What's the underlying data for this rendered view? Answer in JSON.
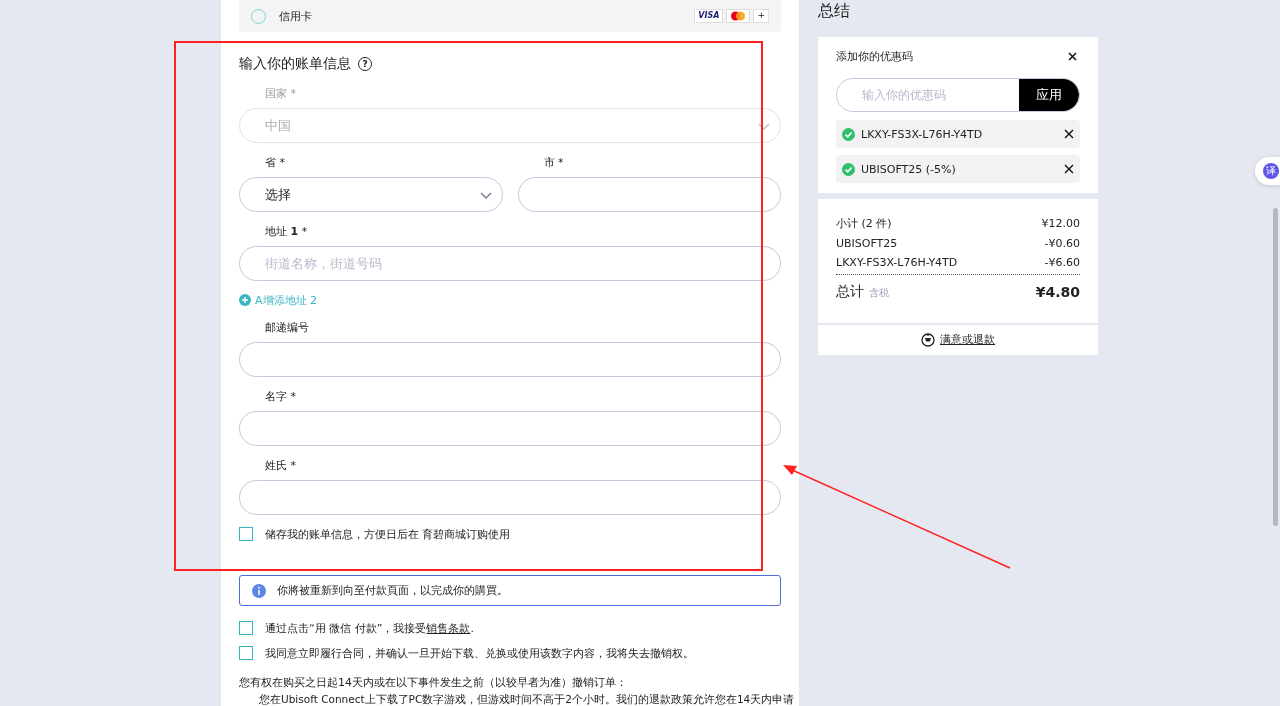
{
  "payment_option": {
    "label": "信用卡",
    "selected": false,
    "visa": "VISA",
    "more": "+"
  },
  "billing": {
    "title": "输入你的账单信息",
    "help": "?",
    "items": [
      {
        "kind": "field",
        "label": "国家 *",
        "value": "中国",
        "select": true,
        "disabled": true
      },
      {
        "kind": "pair",
        "fields": [
          {
            "label": "省 *",
            "value": "选择",
            "select": true,
            "disabled": false
          },
          {
            "label": "市 *",
            "select": false,
            "disabled": false
          }
        ]
      },
      {
        "kind": "field",
        "label": "地址 **1** *",
        "placeholder": "街道名称，街道号码",
        "select": false,
        "disabled": false
      },
      {
        "kind": "link",
        "label": "A增添地址 2"
      },
      {
        "kind": "field",
        "label": "邮递编号",
        "select": false,
        "disabled": false
      },
      {
        "kind": "field",
        "label": "名字 *",
        "select": false,
        "disabled": false
      },
      {
        "kind": "field",
        "label": "姓氏 *",
        "select": false,
        "disabled": false
      },
      {
        "kind": "checkbox",
        "label": "储存我的账单信息，方便日后在 育碧商城订购使用",
        "checked": false
      }
    ]
  },
  "notice": "你將被重新到向至付款頁面，以完成你的購買。",
  "consents": [
    {
      "text": "通过点击“用 微信 付款”，我接受",
      "link": "销售条款",
      "after": ".",
      "checked": false
    },
    {
      "text": "我同意立即履行合同，并确认一旦开始下载、兑换或使用该数字内容，我将失去撤销权。",
      "checked": false
    }
  ],
  "withdrawal": {
    "intro": "您有权在购买之日起14天内或在以下事件发生之前（以较早者为准）撤销订单：",
    "bullet": "您在Ubisoft Connect上下载了PC数字游戏，但游戏时间不高于2个小时。我们的退款政策允许您在14天内申请"
  },
  "summary": {
    "title": "总结",
    "coupon": {
      "title": "添加你的优惠码",
      "placeholder": "输入你的优惠码",
      "apply": "应用",
      "codes": [
        "LKXY-FS3X-L76H-Y4TD",
        "UBISOFT25 (-5%)"
      ]
    },
    "lines": [
      {
        "label": "小计 (2 件)",
        "amount": "¥12.00"
      },
      {
        "label": "UBISOFT25",
        "amount": "-¥0.60"
      },
      {
        "label": "LKXY-FS3X-L76H-Y4TD",
        "amount": "-¥6.60"
      }
    ],
    "total": {
      "label": "总计",
      "note": "含税",
      "amount": "¥4.80"
    },
    "guarantee": "满意或退款"
  },
  "translate_bubble": "译"
}
